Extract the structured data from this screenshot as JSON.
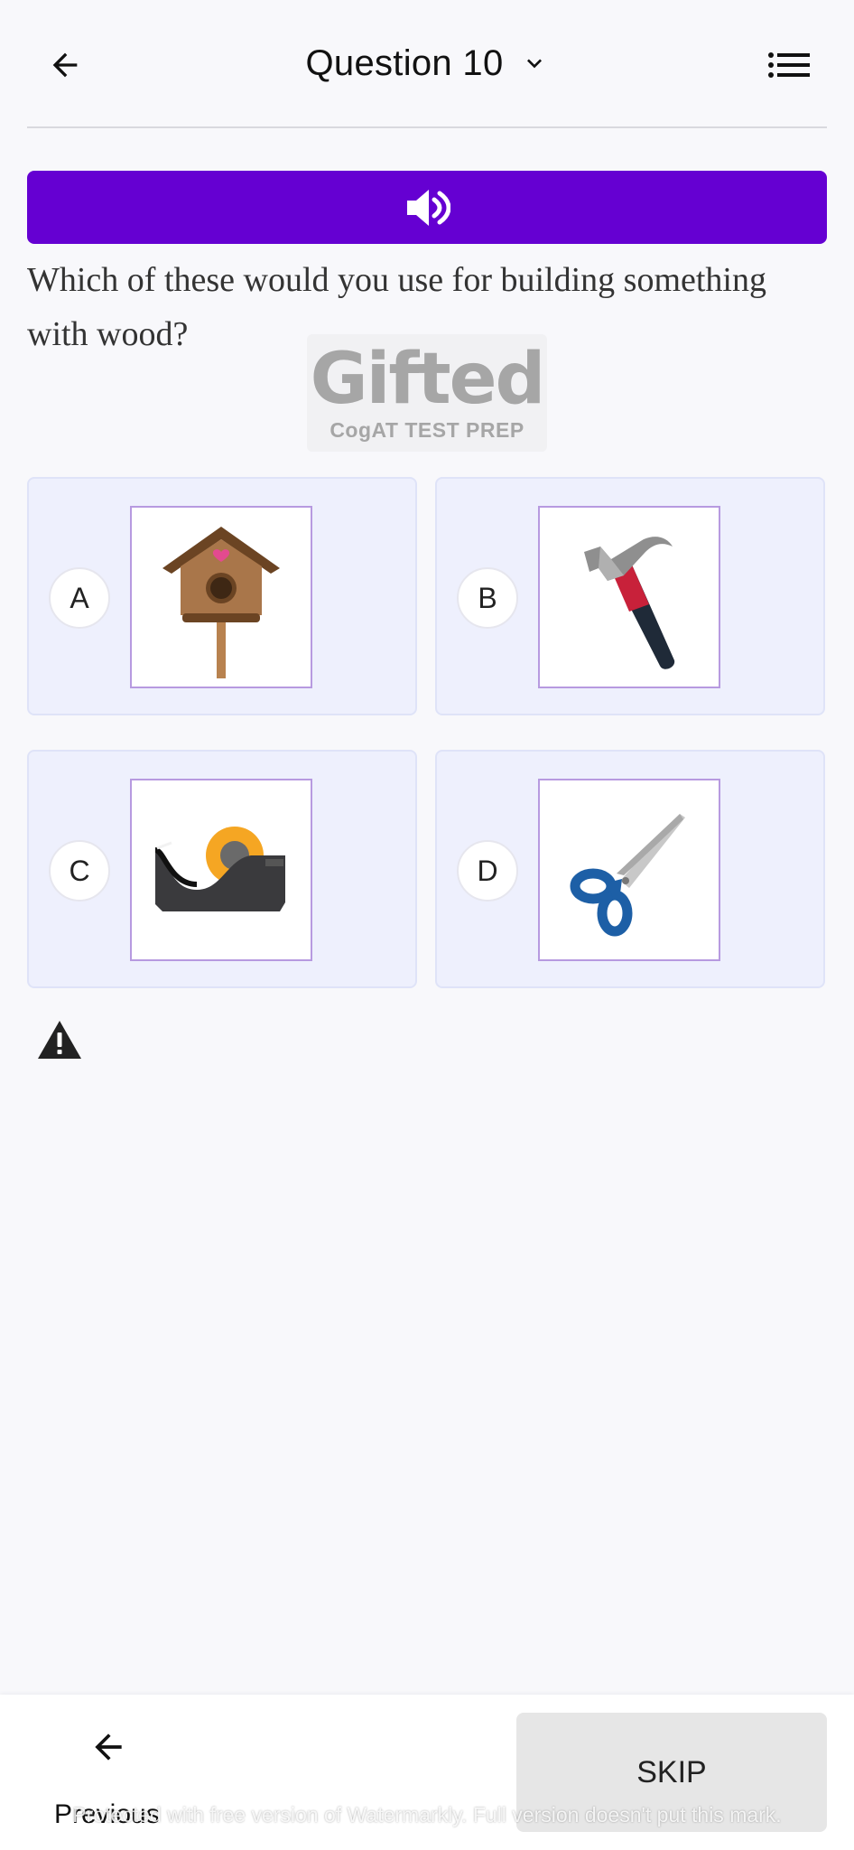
{
  "header": {
    "title": "Question 10"
  },
  "question": {
    "text": "Which of these would you use for building something with wood?"
  },
  "logo": {
    "word": "Gifted",
    "subtitle": "CogAT TEST PREP"
  },
  "options": [
    {
      "letter": "A",
      "image": "birdhouse-image"
    },
    {
      "letter": "B",
      "image": "hammer-image"
    },
    {
      "letter": "C",
      "image": "tape-dispenser-image"
    },
    {
      "letter": "D",
      "image": "scissors-image"
    }
  ],
  "footer": {
    "previous_label": "Previous",
    "skip_label": "SKIP",
    "watermark": "Protected with free version of Watermarkly. Full version doesn't put this mark."
  },
  "colors": {
    "accent": "#6500d2",
    "option_bg": "#eef0fd",
    "image_border": "#b79ae0"
  }
}
